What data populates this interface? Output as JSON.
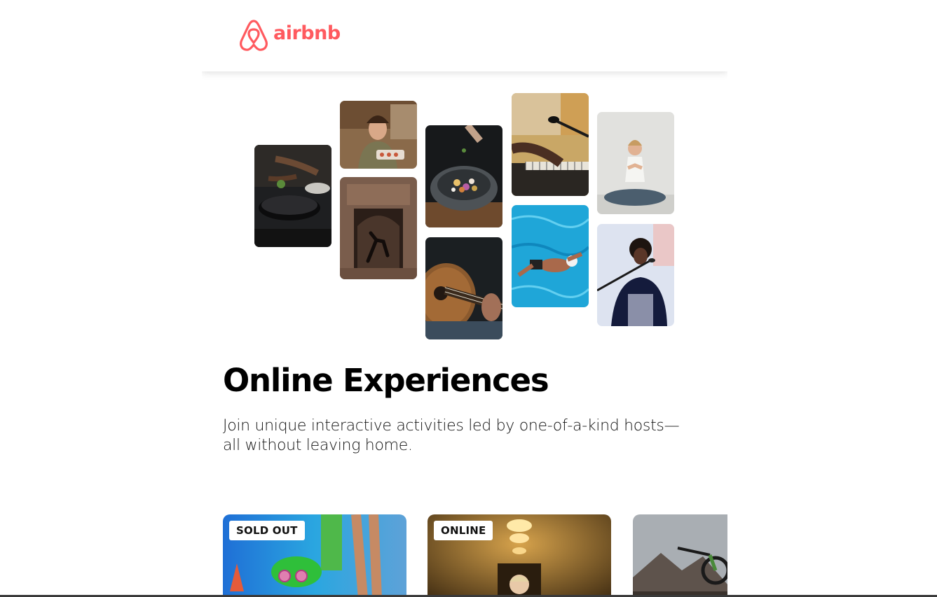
{
  "brand": {
    "name": "airbnb",
    "color": "#FF5A5F"
  },
  "hero": {
    "title": "Online Experiences",
    "subtitle": "Join unique interactive activities led by one-of-a-kind hosts—all without leaving home."
  },
  "cards": [
    {
      "badge": "SOLD OUT"
    },
    {
      "badge": "ONLINE"
    },
    {
      "badge": ""
    }
  ]
}
